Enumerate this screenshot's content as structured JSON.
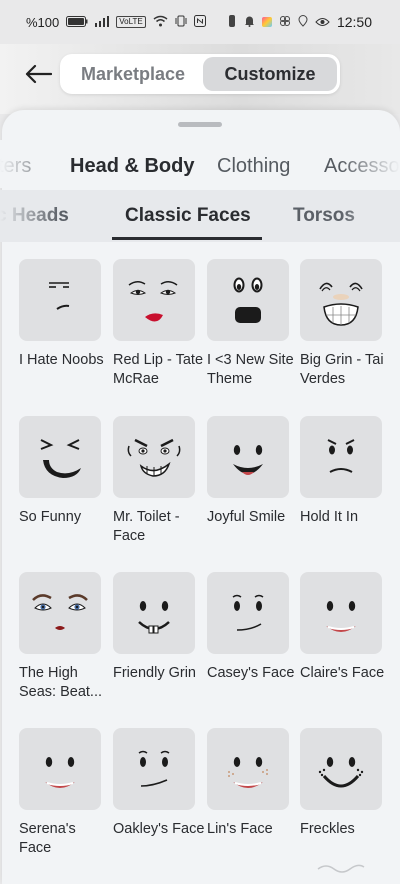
{
  "status_bar": {
    "battery": "%100",
    "time": "12:50"
  },
  "header": {
    "back_icon": "arrow-left-icon",
    "segments": [
      {
        "label": "Marketplace",
        "active": false
      },
      {
        "label": "Customize",
        "active": true
      }
    ]
  },
  "tabs": [
    {
      "label": "ters",
      "active": false
    },
    {
      "label": "Head & Body",
      "active": true
    },
    {
      "label": "Clothing",
      "active": false
    },
    {
      "label": "Accesso",
      "active": false
    }
  ],
  "subtabs": [
    {
      "label": "c Heads",
      "active": false
    },
    {
      "label": "Classic Faces",
      "active": true
    },
    {
      "label": "Torsos",
      "active": false
    }
  ],
  "items": [
    {
      "name": "I Hate Noobs",
      "face": "hate"
    },
    {
      "name": "Red Lip - Tate McRae",
      "face": "redlip"
    },
    {
      "name": "I <3 New Site Theme",
      "face": "sitetheme"
    },
    {
      "name": "Big Grin - Tai Verdes",
      "face": "biggrin"
    },
    {
      "name": "So Funny",
      "face": "sofunny"
    },
    {
      "name": "Mr. Toilet - Face",
      "face": "toilet"
    },
    {
      "name": "Joyful Smile",
      "face": "joyful"
    },
    {
      "name": "Hold It In",
      "face": "holdit"
    },
    {
      "name": "The High Seas: Beat...",
      "face": "highseas"
    },
    {
      "name": "Friendly Grin",
      "face": "friendly"
    },
    {
      "name": "Casey's Face",
      "face": "casey"
    },
    {
      "name": "Claire's Face",
      "face": "claire"
    },
    {
      "name": "Serena's Face",
      "face": "serena"
    },
    {
      "name": "Oakley's Face",
      "face": "oakley"
    },
    {
      "name": "Lin's Face",
      "face": "lin"
    },
    {
      "name": "Freckles",
      "face": "freckles"
    }
  ],
  "colors": {
    "sheet_bg": "#f2f4f6",
    "thumb_bg": "#dfe0e2",
    "active_text": "#2a2c30",
    "lip_red": "#c8102e"
  }
}
